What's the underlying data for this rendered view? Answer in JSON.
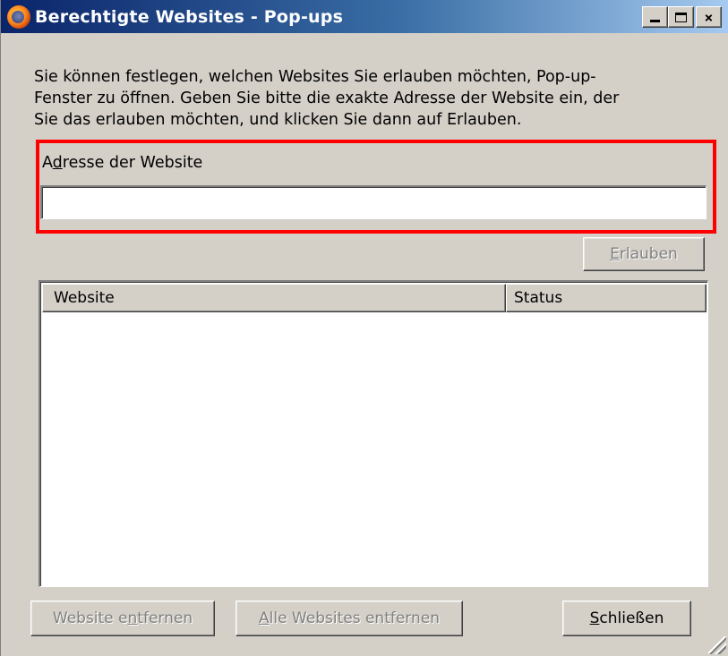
{
  "window": {
    "title": "Berechtigte Websites - Pop-ups",
    "app_icon": "firefox-icon",
    "controls": {
      "minimize": "minimize-icon",
      "maximize": "maximize-icon",
      "close": "×"
    }
  },
  "intro_text": "Sie können festlegen, welchen Websites Sie erlauben möchten, Pop-up-\nFenster zu öffnen. Geben Sie bitte die exakte Adresse der Website ein, der\nSie das erlauben möchten, und klicken Sie dann auf Erlauben.",
  "address": {
    "label_prefix": "A",
    "label_access": "d",
    "label_rest": "resse der Website",
    "value": "",
    "placeholder": ""
  },
  "buttons": {
    "allow": {
      "access": "E",
      "rest": "rlauben"
    },
    "remove_site": {
      "before": "Website e",
      "access": "n",
      "after": "tfernen"
    },
    "remove_all": {
      "access": "A",
      "rest": "lle Websites entfernen"
    },
    "close": {
      "access": "S",
      "rest": "chließen"
    }
  },
  "list": {
    "columns": [
      "Website",
      "Status"
    ],
    "rows": []
  },
  "colors": {
    "highlight": "#ff0000",
    "titlebar_start": "#0a246a",
    "titlebar_end": "#a6caf0",
    "face": "#d4d0c8"
  }
}
